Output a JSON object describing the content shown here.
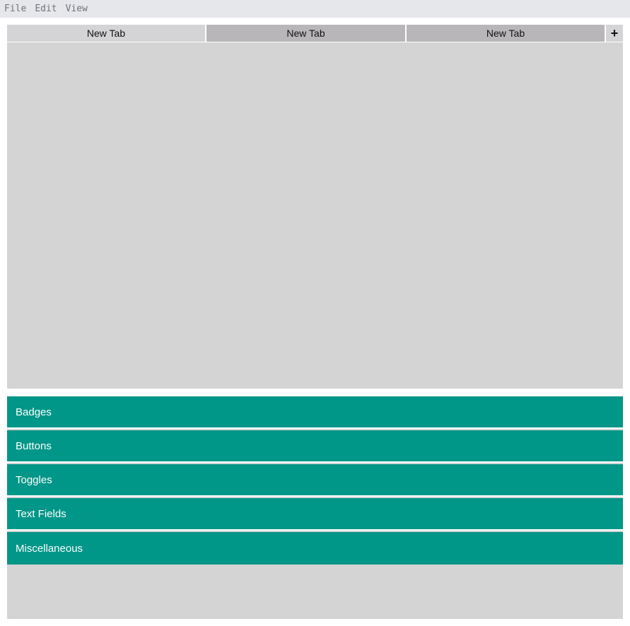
{
  "menu": {
    "items": [
      "File",
      "Edit",
      "View"
    ]
  },
  "tabs": [
    {
      "label": "New Tab",
      "active": true
    },
    {
      "label": "New Tab",
      "active": false
    },
    {
      "label": "New Tab",
      "active": false
    }
  ],
  "add_tab_label": "+",
  "accordion": [
    {
      "label": "Badges"
    },
    {
      "label": "Buttons"
    },
    {
      "label": "Toggles"
    },
    {
      "label": "Text Fields"
    },
    {
      "label": "Miscellaneous"
    }
  ],
  "colors": {
    "accent": "#009688",
    "menubar": "#e6e7eb",
    "panel": "#d4d4d4",
    "tab_active": "#d4d3d5",
    "tab_inactive": "#b8b6b9"
  }
}
